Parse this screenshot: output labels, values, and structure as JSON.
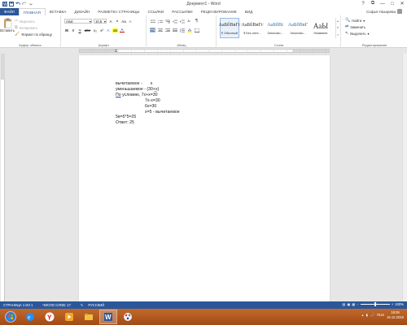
{
  "window": {
    "title": "Документ1 - Word",
    "controls": {
      "help": "?",
      "restore": "⧉",
      "minimize": "—",
      "maximize": "□",
      "close": "✕"
    }
  },
  "tabs": [
    "ФАЙЛ",
    "ГЛАВНАЯ",
    "ВСТАВКА",
    "ДИЗАЙН",
    "РАЗМЕТКА СТРАНИЦЫ",
    "ССЫЛКИ",
    "РАССЫЛКИ",
    "РЕЦЕНЗИРОВАНИЕ",
    "ВИД"
  ],
  "user": {
    "name": "Софья Лазарева"
  },
  "ribbon": {
    "clipboard": {
      "paste_label": "Вставить",
      "cut_label": "Вырезать",
      "copy_label": "Копировать",
      "format_painter_label": "Формат по образцу",
      "group_label": "Буфер обмена"
    },
    "font": {
      "font_name": "Arial",
      "font_size": "10,5",
      "grow": "A",
      "shrink": "A",
      "case": "Aa",
      "clear": "A",
      "bold": "Ж",
      "italic": "К",
      "underline": "Ч",
      "strike": "abc",
      "subscript": "x₂",
      "superscript": "x²",
      "effects": "A",
      "highlight": "ab",
      "color": "A",
      "group_label": "Шрифт"
    },
    "paragraph": {
      "group_label": "Абзац",
      "sort": "A↓",
      "pilcrow": "¶"
    },
    "styles": {
      "items": [
        {
          "sample": "АаБбВвГг",
          "name": "¶ Обычный"
        },
        {
          "sample": "АаБбВвГг",
          "name": "¶ Без инте..."
        },
        {
          "sample": "АаБбВі",
          "name": "Заголово..."
        },
        {
          "sample": "АаБбВвГ",
          "name": "Заголово..."
        },
        {
          "sample": "АаЫ",
          "name": "Название"
        }
      ],
      "group_label": "Стили"
    },
    "editing": {
      "find": "Найти",
      "replace": "Заменить",
      "select": "Выделить",
      "group_label": "Редактирование"
    }
  },
  "document": {
    "lines": [
      {
        "text": "вычитаемое -       х"
      },
      {
        "pre": "уменьшаемое - (30+",
        "mid": "х)",
        "post": ""
      },
      {
        "pre": "",
        "under": "По",
        "post": " условию, 7х+х=30"
      },
      {
        "text": "                         7х-х=30"
      },
      {
        "text": "                         6х=30"
      },
      {
        "text": "                         х=5 - вычитаемое"
      },
      {
        "text": "5в=5*5=25"
      },
      {
        "text": "Ответ: 25"
      }
    ]
  },
  "statusbar": {
    "page": "СТРАНИЦА 1 ИЗ 1",
    "words": "ЧИСЛО СЛОВ: 17",
    "lang": "РУССКИЙ",
    "zoom": "100%",
    "zoom_minus": "−",
    "zoom_plus": "+"
  },
  "taskbar": {
    "lang": "RUS",
    "time": "19:29",
    "date": "16.12.2015",
    "apps": [
      "start",
      "explorer",
      "yandex",
      "media",
      "files",
      "word",
      "paint"
    ]
  },
  "colors": {
    "word_blue": "#2b579a",
    "taskbar": "#b0541a"
  }
}
